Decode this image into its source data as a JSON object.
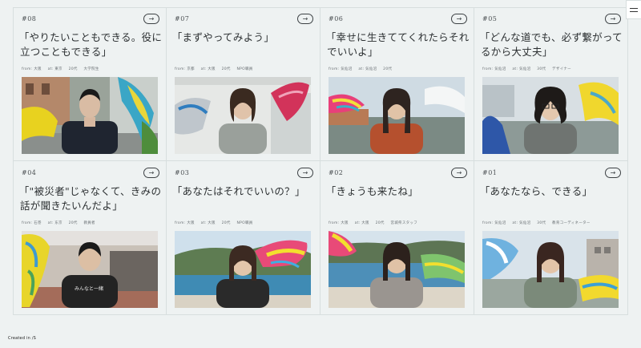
{
  "cards": [
    {
      "num": "#08",
      "quote": "「やりたいこともできる。役に立つこともできる」",
      "from": "from: 大阪",
      "at": "at: 東京",
      "age": "20代",
      "role": "大学院生"
    },
    {
      "num": "#07",
      "quote": "「まずやってみよう」",
      "from": "from: 京都",
      "at": "at: 大阪",
      "age": "20代",
      "role": "NPO職員"
    },
    {
      "num": "#06",
      "quote": "「幸せに生きててくれたらそれでいいよ」",
      "from": "from: 気仙沼",
      "at": "at: 気仙沼",
      "age": "20代",
      "role": ""
    },
    {
      "num": "#05",
      "quote": "「どんな道でも、必ず繋がってるから大丈夫」",
      "from": "from: 気仙沼",
      "at": "at: 気仙沼",
      "age": "30代",
      "role": "デザイナー"
    },
    {
      "num": "#04",
      "quote": "「\"被災者\"じゃなくて、きみの話が聞きたいんだよ」",
      "from": "from: 石巻",
      "at": "at: 东京",
      "age": "20代",
      "role": "教員者"
    },
    {
      "num": "#03",
      "quote": "「あなたはそれでいいの？」",
      "from": "from: 大阪",
      "at": "at: 大阪",
      "age": "20代",
      "role": "NPO職員"
    },
    {
      "num": "#02",
      "quote": "「きょうも来たね」",
      "from": "from: 大阪",
      "at": "at: 大阪",
      "age": "20代",
      "role": "宮城県スタッフ"
    },
    {
      "num": "#01",
      "quote": "「あなたなら、できる」",
      "from": "from: 気仙沼",
      "at": "at: 気仙沼",
      "age": "30代",
      "role": "教育コーディネーター"
    }
  ],
  "icons": {
    "arrow": "arrow-right-icon",
    "menu": "hamburger-menu-icon"
  },
  "arrow_glyph": "→",
  "credit": "Created in ∕S"
}
